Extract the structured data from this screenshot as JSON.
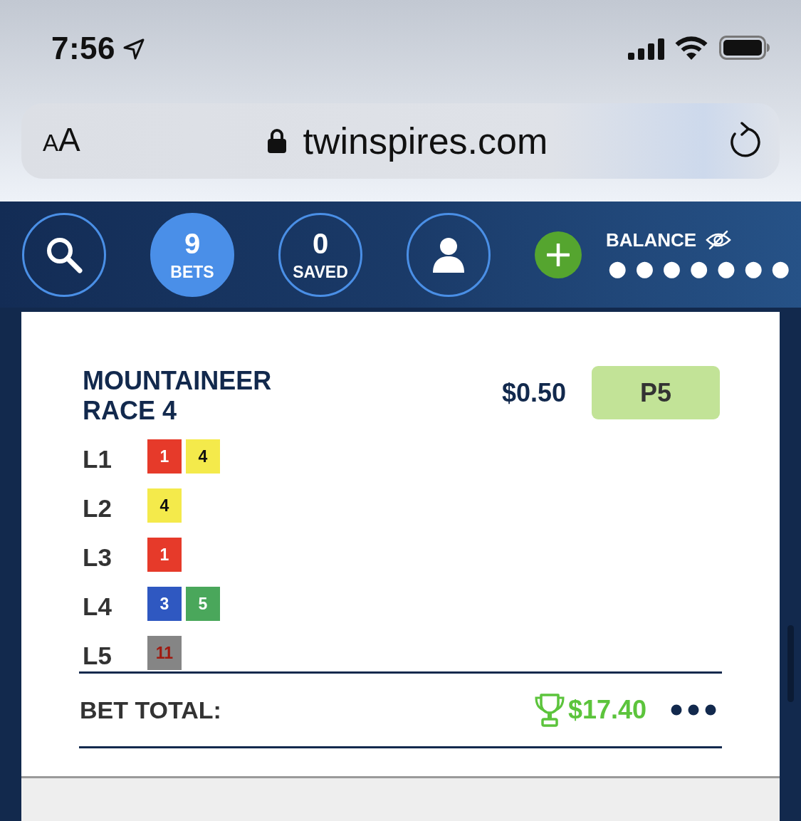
{
  "status_bar": {
    "time": "7:56"
  },
  "browser": {
    "text_size": "AA",
    "secure": true,
    "url": "twinspires.com"
  },
  "nav": {
    "items": [
      {
        "kind": "search",
        "selected": false
      },
      {
        "kind": "counter",
        "count": "9",
        "label": "BETS",
        "selected": true
      },
      {
        "kind": "counter",
        "count": "0",
        "label": "SAVED",
        "selected": false
      },
      {
        "kind": "account",
        "selected": false
      }
    ],
    "balance": {
      "label": "BALANCE",
      "masked_value": "●●●●●●●"
    }
  },
  "bet": {
    "title": "MOUNTAINEER RACE 4",
    "amount": "$0.50",
    "bet_type": "P5",
    "legs": [
      {
        "label": "L1",
        "runners": [
          {
            "number": "1",
            "color": "#e63a2a",
            "kind": "light"
          },
          {
            "number": "4",
            "color": "#f4ea4b",
            "kind": "dark"
          }
        ]
      },
      {
        "label": "L2",
        "runners": [
          {
            "number": "4",
            "color": "#f4ea4b",
            "kind": "dark"
          }
        ]
      },
      {
        "label": "L3",
        "runners": [
          {
            "number": "1",
            "color": "#e63a2a",
            "kind": "light"
          }
        ]
      },
      {
        "label": "L4",
        "runners": [
          {
            "number": "3",
            "color": "#2f58c1",
            "kind": "light"
          },
          {
            "number": "5",
            "color": "#4aa75b",
            "kind": "light"
          }
        ]
      },
      {
        "label": "L5",
        "runners": [
          {
            "number": "11",
            "color": "#858585",
            "kind": "red"
          }
        ]
      }
    ],
    "total_label": "BET TOTAL:",
    "won": true,
    "total": "$17.40"
  }
}
